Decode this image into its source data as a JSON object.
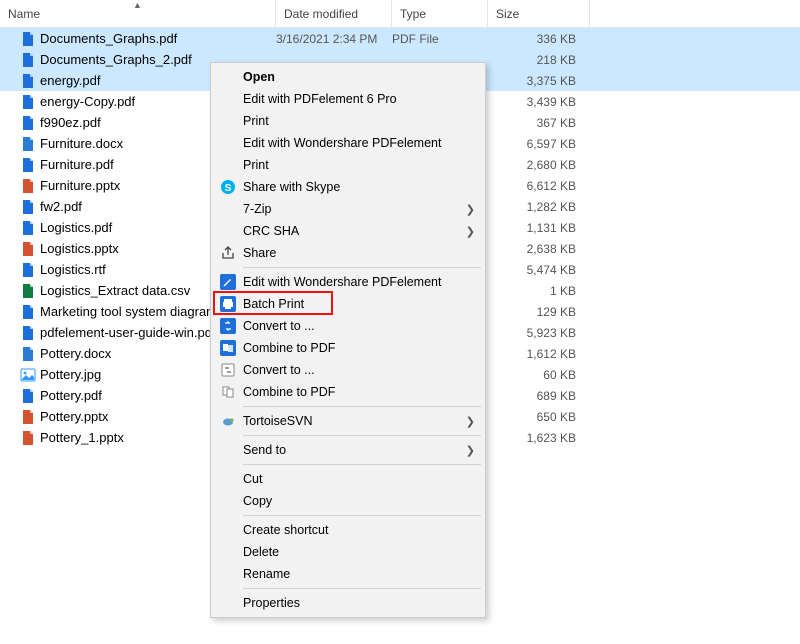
{
  "columns": {
    "name": "Name",
    "date": "Date modified",
    "type": "Type",
    "size": "Size"
  },
  "files": [
    {
      "name": "Documents_Graphs.pdf",
      "date": "3/16/2021 2:34 PM",
      "type": "PDF File",
      "size": "336 KB",
      "icon": "pdf",
      "selected": true
    },
    {
      "name": "Documents_Graphs_2.pdf",
      "date": "",
      "type": "",
      "size": "218 KB",
      "icon": "pdf",
      "selected": true
    },
    {
      "name": "energy.pdf",
      "date": "",
      "type": "",
      "size": "3,375 KB",
      "icon": "pdf",
      "selected": true
    },
    {
      "name": "energy-Copy.pdf",
      "date": "",
      "type": "",
      "size": "3,439 KB",
      "icon": "pdf",
      "selected": false
    },
    {
      "name": "f990ez.pdf",
      "date": "",
      "type": "",
      "size": "367 KB",
      "icon": "pdf",
      "selected": false
    },
    {
      "name": "Furniture.docx",
      "date": "",
      "type": "",
      "size": "6,597 KB",
      "icon": "docx",
      "selected": false
    },
    {
      "name": "Furniture.pdf",
      "date": "",
      "type": "",
      "size": "2,680 KB",
      "icon": "pdf",
      "selected": false
    },
    {
      "name": "Furniture.pptx",
      "date": "",
      "type": "",
      "size": "6,612 KB",
      "icon": "pptx",
      "selected": false
    },
    {
      "name": "fw2.pdf",
      "date": "",
      "type": "",
      "size": "1,282 KB",
      "icon": "pdf",
      "selected": false
    },
    {
      "name": "Logistics.pdf",
      "date": "",
      "type": "",
      "size": "1,131 KB",
      "icon": "pdf",
      "selected": false
    },
    {
      "name": "Logistics.pptx",
      "date": "",
      "type": "",
      "size": "2,638 KB",
      "icon": "pptx",
      "selected": false
    },
    {
      "name": "Logistics.rtf",
      "date": "",
      "type": "",
      "size": "5,474 KB",
      "icon": "rtf",
      "selected": false
    },
    {
      "name": "Logistics_Extract data.csv",
      "date": "",
      "type": "",
      "size": "1 KB",
      "icon": "csv",
      "selected": false
    },
    {
      "name": "Marketing tool system diagram",
      "date": "",
      "type": "",
      "size": "129 KB",
      "icon": "pdf",
      "selected": false
    },
    {
      "name": "pdfelement-user-guide-win.pdf",
      "date": "",
      "type": "",
      "size": "5,923 KB",
      "icon": "pdf",
      "selected": false
    },
    {
      "name": "Pottery.docx",
      "date": "",
      "type": "",
      "size": "1,612 KB",
      "icon": "docx",
      "selected": false
    },
    {
      "name": "Pottery.jpg",
      "date": "",
      "type": "",
      "size": "60 KB",
      "icon": "jpg",
      "selected": false
    },
    {
      "name": "Pottery.pdf",
      "date": "",
      "type": "",
      "size": "689 KB",
      "icon": "pdf",
      "selected": false
    },
    {
      "name": "Pottery.pptx",
      "date": "",
      "type": "",
      "size": "650 KB",
      "icon": "pptx",
      "selected": false
    },
    {
      "name": "Pottery_1.pptx",
      "date": "",
      "type": "",
      "size": "1,623 KB",
      "icon": "pptx",
      "selected": false
    }
  ],
  "menu": [
    {
      "kind": "item",
      "label": "Open",
      "bold": true,
      "icon": ""
    },
    {
      "kind": "item",
      "label": "Edit with PDFelement 6 Pro",
      "icon": ""
    },
    {
      "kind": "item",
      "label": "Print",
      "icon": ""
    },
    {
      "kind": "item",
      "label": "Edit with Wondershare PDFelement",
      "icon": ""
    },
    {
      "kind": "item",
      "label": "Print",
      "icon": ""
    },
    {
      "kind": "item",
      "label": "Share with Skype",
      "icon": "skype"
    },
    {
      "kind": "item",
      "label": "7-Zip",
      "icon": "",
      "submenu": true
    },
    {
      "kind": "item",
      "label": "CRC SHA",
      "icon": "",
      "submenu": true
    },
    {
      "kind": "item",
      "label": "Share",
      "icon": "share"
    },
    {
      "kind": "sep"
    },
    {
      "kind": "item",
      "label": "Edit with Wondershare PDFelement",
      "icon": "edit-blue"
    },
    {
      "kind": "item",
      "label": "Batch Print",
      "icon": "print-blue",
      "highlight": true
    },
    {
      "kind": "item",
      "label": "Convert to ...",
      "icon": "convert-blue"
    },
    {
      "kind": "item",
      "label": "Combine to PDF",
      "icon": "combine-blue"
    },
    {
      "kind": "item",
      "label": "Convert to ...",
      "icon": "convert-gray"
    },
    {
      "kind": "item",
      "label": "Combine to PDF",
      "icon": "combine-gray"
    },
    {
      "kind": "sep"
    },
    {
      "kind": "item",
      "label": "TortoiseSVN",
      "icon": "tortoise",
      "submenu": true
    },
    {
      "kind": "sep"
    },
    {
      "kind": "item",
      "label": "Send to",
      "icon": "",
      "submenu": true
    },
    {
      "kind": "sep"
    },
    {
      "kind": "item",
      "label": "Cut",
      "icon": ""
    },
    {
      "kind": "item",
      "label": "Copy",
      "icon": ""
    },
    {
      "kind": "sep"
    },
    {
      "kind": "item",
      "label": "Create shortcut",
      "icon": ""
    },
    {
      "kind": "item",
      "label": "Delete",
      "icon": ""
    },
    {
      "kind": "item",
      "label": "Rename",
      "icon": ""
    },
    {
      "kind": "sep"
    },
    {
      "kind": "item",
      "label": "Properties",
      "icon": ""
    }
  ]
}
